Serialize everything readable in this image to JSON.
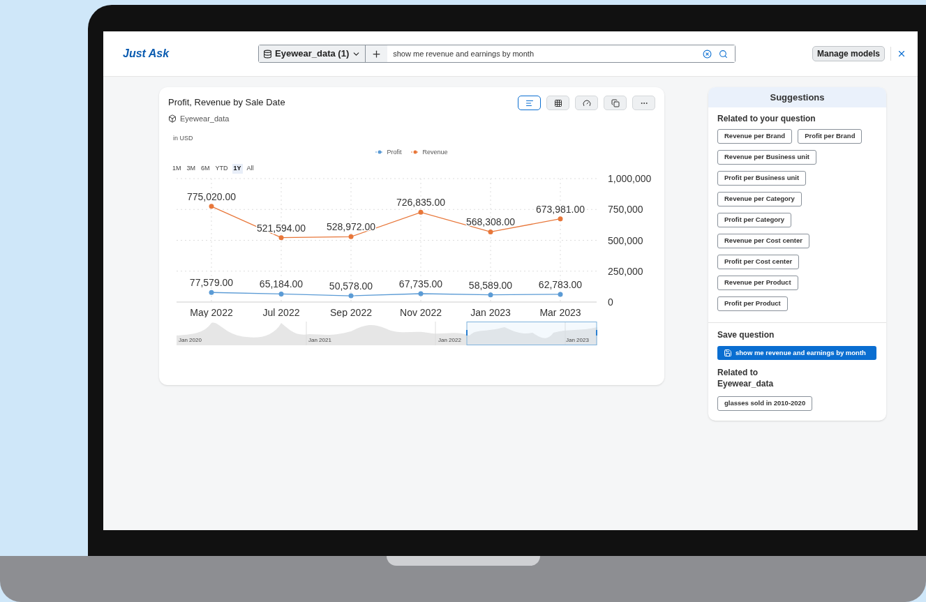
{
  "header": {
    "app_title": "Just Ask",
    "dataset_selector": "Eyewear_data (1)",
    "query": "show me revenue and earnings by month",
    "manage_button": "Manage models"
  },
  "card": {
    "title": "Profit, Revenue by Sale Date",
    "dataset": "Eyewear_data",
    "toolbar": [
      {
        "kind": "chart",
        "selected": true
      },
      {
        "kind": "table",
        "selected": false
      },
      {
        "kind": "gauge",
        "selected": false
      },
      {
        "kind": "copy",
        "selected": false
      },
      {
        "kind": "more",
        "selected": false
      }
    ],
    "unit": "in USD",
    "ranges": [
      {
        "label": "1M",
        "selected": false
      },
      {
        "label": "3M",
        "selected": false
      },
      {
        "label": "6M",
        "selected": false
      },
      {
        "label": "YTD",
        "selected": false
      },
      {
        "label": "1Y",
        "selected": true
      },
      {
        "label": "All",
        "selected": false
      }
    ],
    "chart_data": {
      "type": "line",
      "grid": true,
      "categories": [
        "May 2022",
        "Jul 2022",
        "Sep 2022",
        "Nov 2022",
        "Jan 2023",
        "Mar 2023"
      ],
      "yticks": [
        {
          "value": 0,
          "label": "0"
        },
        {
          "value": 250000,
          "label": "250,000"
        },
        {
          "value": 500000,
          "label": "500,000"
        },
        {
          "value": 750000,
          "label": "750,000"
        },
        {
          "value": 1000000,
          "label": "1,000,000"
        }
      ],
      "ylim": [
        0,
        1000000
      ],
      "series": [
        {
          "name": "Profit",
          "color": "#5b9bd5",
          "marker": "circle",
          "values": [
            77579,
            65184,
            50578,
            67735,
            58589,
            62783
          ],
          "value_labels": [
            "77,579.00",
            "65,184.00",
            "50,578.00",
            "67,735.00",
            "58,589.00",
            "62,783.00"
          ]
        },
        {
          "name": "Revenue",
          "color": "#e8773a",
          "marker": "circle",
          "values": [
            775020,
            521594,
            528972,
            726835,
            568308,
            673981
          ],
          "value_labels": [
            "775,020.00",
            "521,594.00",
            "528,972.00",
            "726,835.00",
            "568,308.00",
            "673,981.00"
          ]
        }
      ]
    },
    "navigator": {
      "labels": [
        "Jan 2020",
        "Jan 2021",
        "Jan 2022",
        "Jan 2023"
      ]
    }
  },
  "suggestions": {
    "title": "Suggestions",
    "related_heading": "Related to your question",
    "related": [
      "Revenue per Brand",
      "Profit per Brand",
      "Revenue per Business unit",
      "Profit per Business unit",
      "Revenue per Category",
      "Profit per Category",
      "Revenue per Cost center",
      "Profit per Cost center",
      "Revenue per Product",
      "Profit per Product"
    ],
    "save_heading": "Save question",
    "save_button": "show me revenue and earnings by month",
    "dataset_heading": "Related to Eyewear_data",
    "dataset_questions": [
      "glasses sold in 2010-2020"
    ]
  }
}
